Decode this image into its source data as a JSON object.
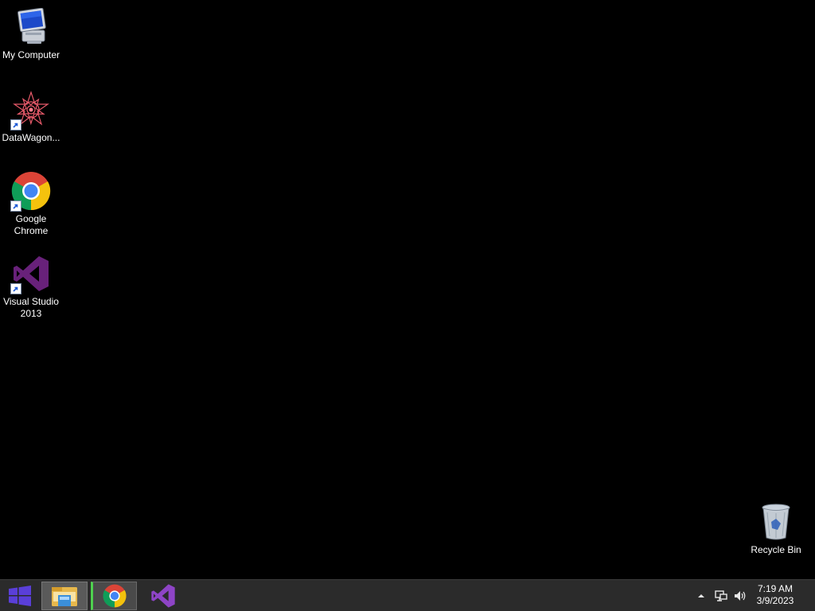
{
  "desktop": {
    "icons": [
      {
        "label": "My Computer",
        "icon": "computer-icon"
      },
      {
        "label": "DataWagon...",
        "icon": "datawagon-icon",
        "shortcut": true
      },
      {
        "label": "Google Chrome",
        "icon": "chrome-icon",
        "shortcut": true
      },
      {
        "label": "Visual Studio 2013",
        "icon": "visual-studio-icon",
        "shortcut": true
      }
    ],
    "recycle_bin": {
      "label": "Recycle Bin",
      "icon": "recycle-bin-icon"
    }
  },
  "taskbar": {
    "start_icon": "windows-logo-icon",
    "pinned": [
      {
        "app": "File Explorer",
        "icon": "file-explorer-icon",
        "state": "pinned"
      },
      {
        "app": "Google Chrome",
        "icon": "chrome-icon",
        "state": "running"
      },
      {
        "app": "Visual Studio 2013",
        "icon": "visual-studio-icon",
        "state": "pinned"
      }
    ],
    "tray": {
      "icons": [
        "show-hidden-icons-chevron-icon",
        "network-icon",
        "volume-icon"
      ],
      "time": "7:19 AM",
      "date": "3/9/2023"
    }
  },
  "colors": {
    "desktop_background": "#000000",
    "taskbar": "#2b2b2b",
    "visual_studio_purple": "#68217a",
    "running_indicator": "#4fd14f"
  }
}
